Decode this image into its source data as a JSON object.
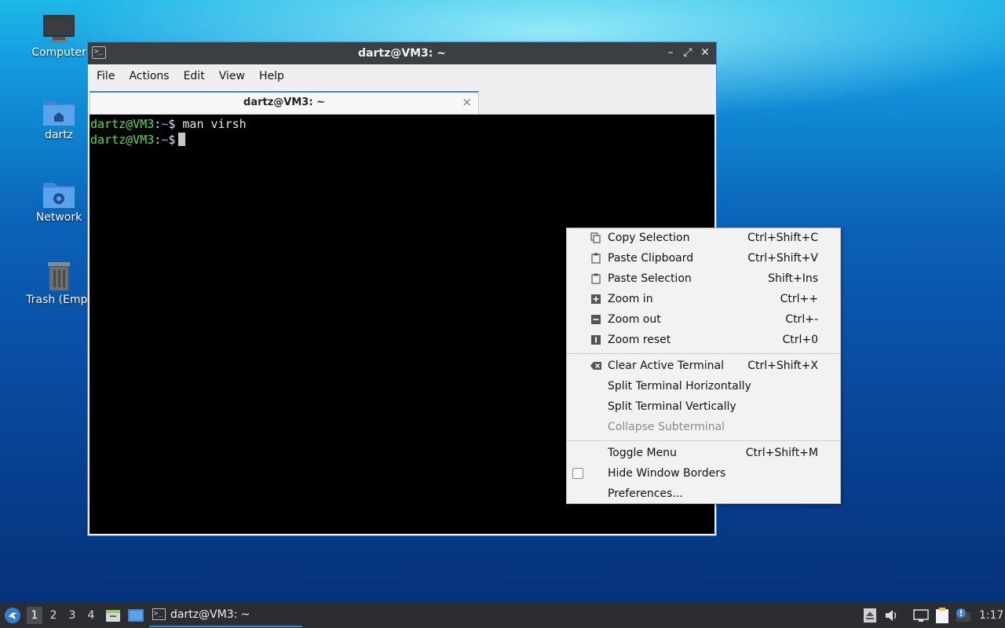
{
  "desktop": {
    "icons": [
      {
        "label": "Computer",
        "icon": "computer-icon"
      },
      {
        "label": "dartz",
        "icon": "home-folder-icon"
      },
      {
        "label": "Network",
        "icon": "network-folder-icon"
      },
      {
        "label": "Trash (Empt",
        "icon": "trash-icon"
      }
    ]
  },
  "window": {
    "title": "dartz@VM3: ~",
    "menu": [
      "File",
      "Actions",
      "Edit",
      "View",
      "Help"
    ],
    "tab_label": "dartz@VM3: ~",
    "tab_close": "×",
    "terminal": {
      "lines": [
        {
          "user": "dartz@VM3",
          "path": "~",
          "cmd": "man virsh"
        },
        {
          "user": "dartz@VM3",
          "path": "~",
          "cmd": ""
        }
      ]
    },
    "colors": {
      "accent": "#3a86d8",
      "prompt_user": "#55e055",
      "prompt_path": "#6fa8ff"
    }
  },
  "context_menu": {
    "groups": [
      [
        {
          "label": "Copy Selection",
          "shortcut": "Ctrl+Shift+C",
          "icon": "copy-icon"
        },
        {
          "label": "Paste Clipboard",
          "shortcut": "Ctrl+Shift+V",
          "icon": "paste-icon"
        },
        {
          "label": "Paste Selection",
          "shortcut": "Shift+Ins",
          "icon": "paste-icon"
        },
        {
          "label": "Zoom in",
          "shortcut": "Ctrl++",
          "icon": "zoom-in-icon"
        },
        {
          "label": "Zoom out",
          "shortcut": "Ctrl+-",
          "icon": "zoom-out-icon"
        },
        {
          "label": "Zoom reset",
          "shortcut": "Ctrl+0",
          "icon": "zoom-reset-icon"
        }
      ],
      [
        {
          "label": "Clear Active Terminal",
          "shortcut": "Ctrl+Shift+X",
          "icon": "clear-icon"
        },
        {
          "label": "Split Terminal Horizontally",
          "shortcut": ""
        },
        {
          "label": "Split Terminal Vertically",
          "shortcut": ""
        },
        {
          "label": "Collapse Subterminal",
          "shortcut": "",
          "disabled": true
        }
      ],
      [
        {
          "label": "Toggle Menu",
          "shortcut": "Ctrl+Shift+M"
        },
        {
          "label": "Hide Window Borders",
          "shortcut": "",
          "checkbox": true,
          "checked": false
        },
        {
          "label": "Preferences...",
          "shortcut": ""
        }
      ]
    ]
  },
  "taskbar": {
    "workspaces": [
      "1",
      "2",
      "3",
      "4"
    ],
    "active_workspace": "1",
    "task_label": "dartz@VM3: ~",
    "clock": "1:17"
  }
}
